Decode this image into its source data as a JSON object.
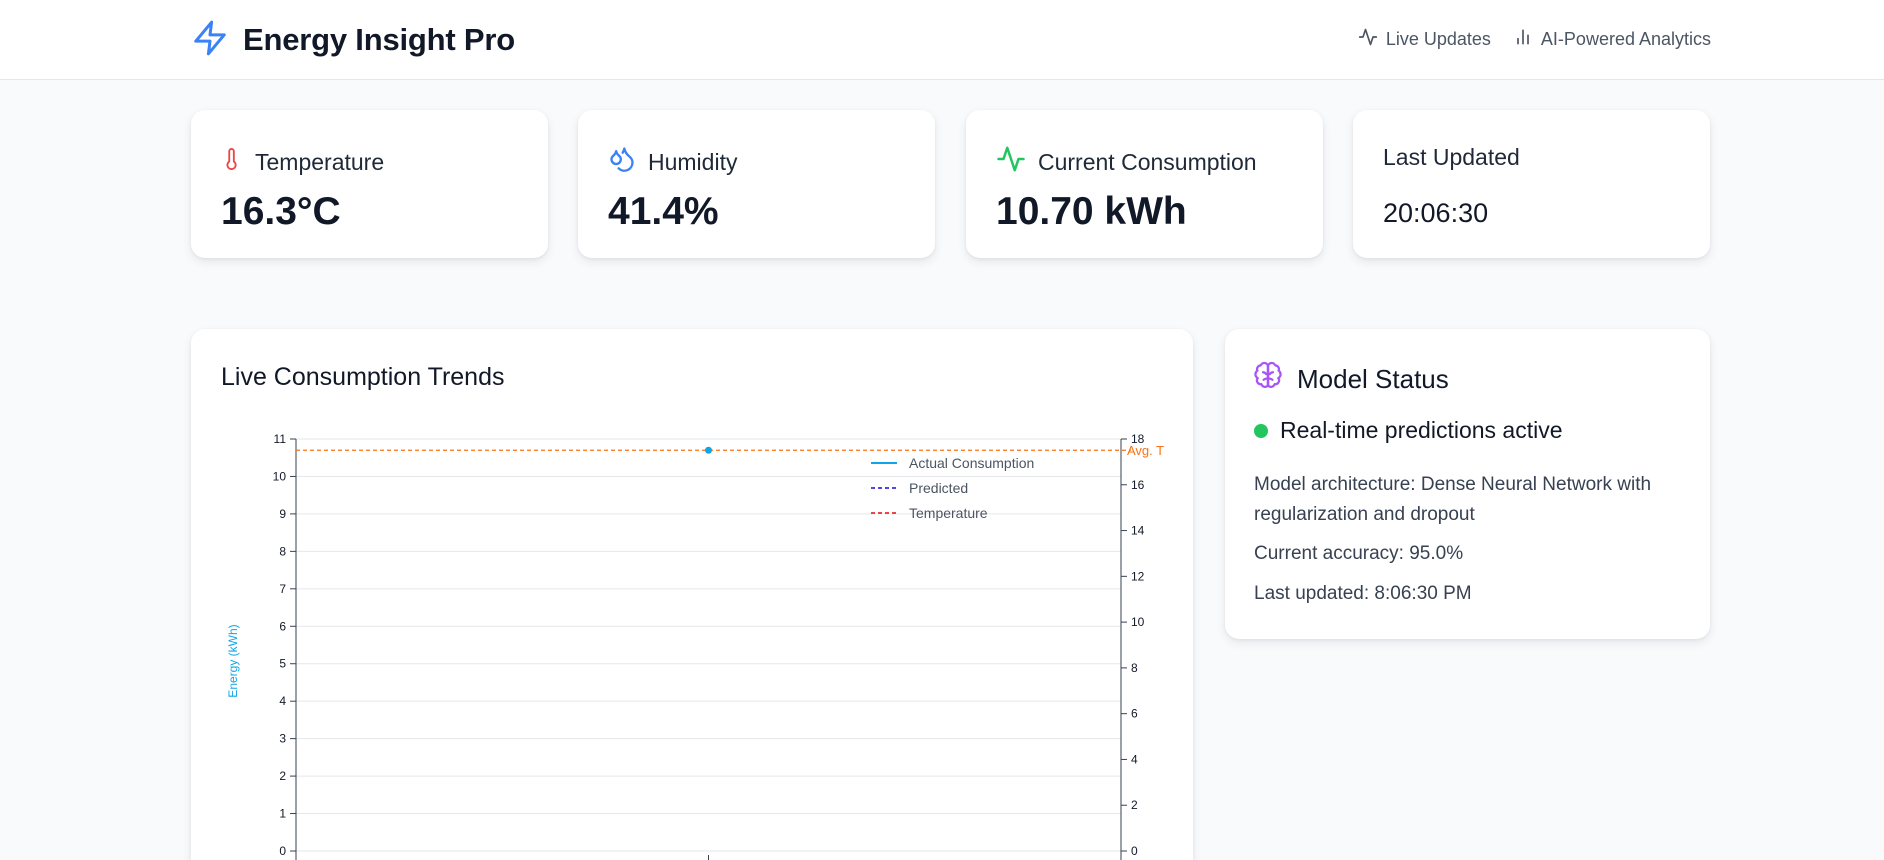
{
  "header": {
    "title": "Energy Insight Pro",
    "nav": [
      {
        "label": "Live Updates",
        "icon": "activity-icon"
      },
      {
        "label": "AI-Powered Analytics",
        "icon": "bar-chart-icon"
      }
    ]
  },
  "stats": [
    {
      "label": "Temperature",
      "value": "16.3°C",
      "icon": "thermometer-icon",
      "color": "#ef4444"
    },
    {
      "label": "Humidity",
      "value": "41.4%",
      "icon": "droplets-icon",
      "color": "#3b82f6"
    },
    {
      "label": "Current Consumption",
      "value": "10.70 kWh",
      "icon": "activity-icon",
      "color": "#22c55e"
    },
    {
      "label": "Last Updated",
      "value": "20:06:30"
    }
  ],
  "chart": {
    "title": "Live Consumption Trends"
  },
  "chart_data": {
    "type": "line",
    "ylabel": "Energy (kWh)",
    "ylim": [
      0,
      11
    ],
    "y2lim": [
      0,
      18
    ],
    "yticks": [
      "0",
      "1",
      "2",
      "3",
      "4",
      "5",
      "6",
      "7",
      "8",
      "9",
      "10",
      "11"
    ],
    "y2ticks": [
      "0",
      "2",
      "4",
      "6",
      "8",
      "10",
      "12",
      "14",
      "16",
      "18"
    ],
    "series": [
      {
        "name": "Actual Consumption",
        "color": "#0ea5e9",
        "style": "solid",
        "values": [
          10.7
        ]
      },
      {
        "name": "Predicted",
        "color": "#4f46e5",
        "style": "dashed",
        "values": []
      },
      {
        "name": "Temperature",
        "color": "#ef4444",
        "style": "dashed",
        "values": []
      }
    ],
    "reference_line": {
      "label": "Avg. T",
      "value": 10.7,
      "color": "#f97316"
    },
    "grid": true,
    "legend": "top-right"
  },
  "model": {
    "title": "Model Status",
    "status": "Real-time predictions active",
    "architecture": "Model architecture: Dense Neural Network with regularization and dropout",
    "accuracy": "Current accuracy: 95.0%",
    "updated": "Last updated: 8:06:30 PM"
  },
  "colors": {
    "accent": "#3b82f6",
    "model_icon": "#a855f7",
    "status_active": "#22c55e"
  }
}
